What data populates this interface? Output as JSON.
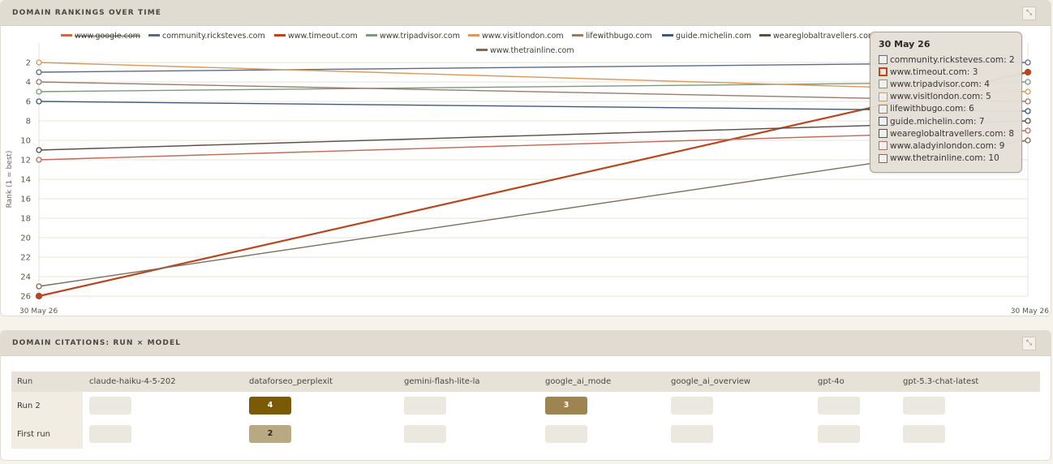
{
  "chart_panel": {
    "title": "DOMAIN RANKINGS OVER TIME",
    "expand_icon": "expand-icon"
  },
  "chart_data": {
    "type": "line",
    "title": "",
    "xlabel": "",
    "ylabel": "Rank (1 = best)",
    "x": [
      "30 May 26",
      "30 May 26"
    ],
    "y_ticks": [
      2,
      4,
      6,
      8,
      10,
      12,
      14,
      16,
      18,
      20,
      22,
      24,
      26
    ],
    "ylim": [
      1,
      26
    ],
    "y_reversed": true,
    "grid": true,
    "legend_position": "top",
    "series": [
      {
        "name": "www.google.com",
        "color": "#c96a55",
        "hidden": true,
        "values": [
          null,
          null
        ]
      },
      {
        "name": "community.ricksteves.com",
        "color": "#5d6b82",
        "values": [
          3,
          2
        ]
      },
      {
        "name": "www.timeout.com",
        "color": "#b8461e",
        "values": [
          26,
          3
        ]
      },
      {
        "name": "www.tripadvisor.com",
        "color": "#7d9a7c",
        "values": [
          5,
          4
        ]
      },
      {
        "name": "www.visitlondon.com",
        "color": "#d79a5c",
        "values": [
          2,
          5
        ]
      },
      {
        "name": "lifewithbugo.com",
        "color": "#9a7a68",
        "values": [
          4,
          6
        ]
      },
      {
        "name": "guide.michelin.com",
        "color": "#3e5a78",
        "values": [
          6,
          7
        ]
      },
      {
        "name": "weareglobaltravellers.com",
        "color": "#5e4e45",
        "values": [
          11,
          8
        ]
      },
      {
        "name": "www.aladyinlondon.com",
        "color": "#c06a5a",
        "values": [
          12,
          9
        ]
      },
      {
        "name": "www.thetrainline.com",
        "color": "#7c6c58",
        "values": [
          25,
          10
        ]
      }
    ]
  },
  "tooltip": {
    "date": "30 May 26",
    "rows": [
      {
        "label": "community.ricksteves.com: 2",
        "color": "#5d6b82"
      },
      {
        "label": "www.timeout.com: 3",
        "color": "#b8461e"
      },
      {
        "label": "www.tripadvisor.com: 4",
        "color": "#7d9a7c"
      },
      {
        "label": "www.visitlondon.com: 5",
        "color": "#d79a5c"
      },
      {
        "label": "lifewithbugo.com: 6",
        "color": "#9a7a68"
      },
      {
        "label": "guide.michelin.com: 7",
        "color": "#3e5a78"
      },
      {
        "label": "weareglobaltravellers.com: 8",
        "color": "#5e4e45"
      },
      {
        "label": "www.aladyinlondon.com: 9",
        "color": "#c06a5a"
      },
      {
        "label": "www.thetrainline.com: 10",
        "color": "#7c6c58"
      }
    ]
  },
  "citations_panel": {
    "title": "DOMAIN CITATIONS: RUN × MODEL",
    "expand_icon": "expand-icon",
    "columns": [
      "Run",
      "claude-haiku-4-5-202",
      "dataforseo_perplexit",
      "gemini-flash-lite-la",
      "google_ai_mode",
      "google_ai_overview",
      "gpt-4o",
      "gpt-5.3-chat-latest"
    ],
    "rows": [
      {
        "label": "Run 2",
        "values": [
          "",
          "4",
          "",
          "3",
          "",
          "",
          ""
        ]
      },
      {
        "label": "First run",
        "values": [
          "",
          "2",
          "",
          "",
          "",
          "",
          ""
        ]
      }
    ]
  }
}
